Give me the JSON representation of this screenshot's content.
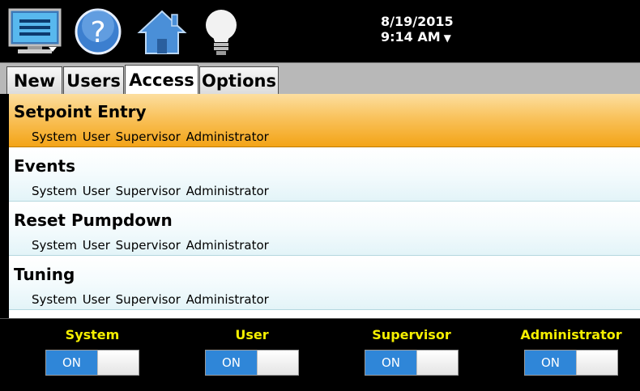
{
  "header": {
    "date": "8/19/2015",
    "time": "9:14 AM",
    "icons": [
      "menu-monitor-icon",
      "help-icon",
      "home-icon",
      "lightbulb-icon"
    ]
  },
  "tabs": [
    {
      "label": "New"
    },
    {
      "label": "Users"
    },
    {
      "label": "Access",
      "active": true
    },
    {
      "label": "Options"
    }
  ],
  "access_list": [
    {
      "title": "Setpoint Entry",
      "roles": "System User Supervisor Administrator",
      "selected": true
    },
    {
      "title": "Events",
      "roles": "System User Supervisor Administrator"
    },
    {
      "title": "Reset Pumpdown",
      "roles": "System User Supervisor Administrator"
    },
    {
      "title": "Tuning",
      "roles": "System User Supervisor Administrator"
    }
  ],
  "toggles": [
    {
      "label": "System",
      "state": "ON"
    },
    {
      "label": "User",
      "state": "ON"
    },
    {
      "label": "Supervisor",
      "state": "ON"
    },
    {
      "label": "Administrator",
      "state": "ON"
    }
  ],
  "colors": {
    "selected_row": "#f6b23a",
    "toggle_on": "#2f86d8",
    "toggle_label": "#f5ef00"
  }
}
